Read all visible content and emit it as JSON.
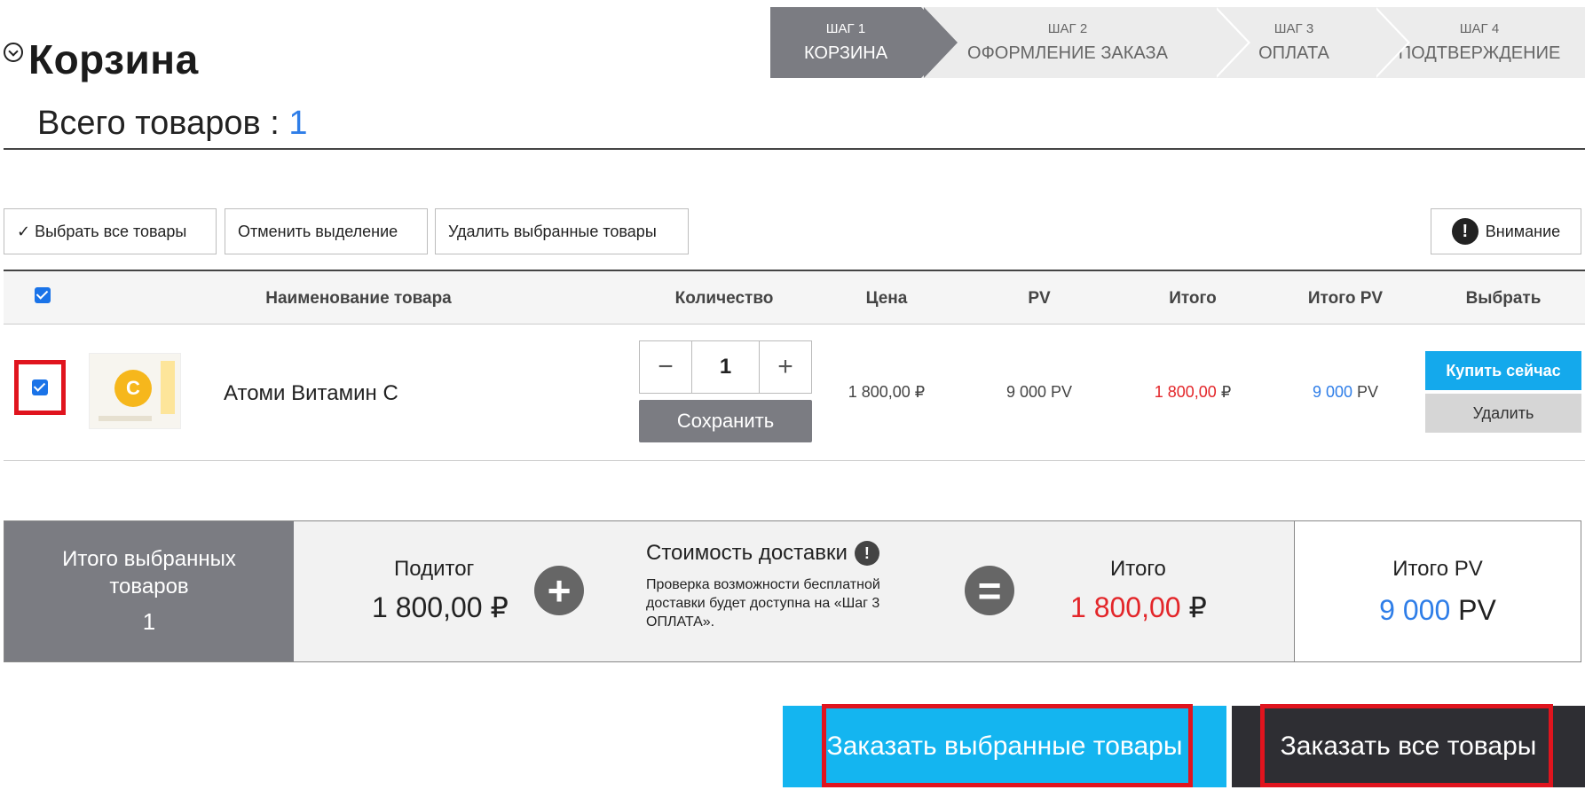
{
  "header": {
    "title": "Корзина",
    "total_label": "Всего товаров : ",
    "total_count": "1"
  },
  "steps": [
    {
      "step": "ШАГ 1",
      "label": "КОРЗИНА",
      "active": true
    },
    {
      "step": "ШАГ 2",
      "label": "ОФОРМЛЕНИЕ ЗАКАЗА",
      "active": false
    },
    {
      "step": "ШАГ 3",
      "label": "ОПЛАТА",
      "active": false
    },
    {
      "step": "ШАГ 4",
      "label": "ПОДТВЕРЖДЕНИЕ",
      "active": false
    }
  ],
  "toolbar": {
    "select_all": "✓ Выбрать все товары",
    "deselect": "Отменить выделение",
    "delete_selected": "Удалить выбранные товары",
    "attention": "Внимание",
    "attention_icon": "!"
  },
  "table": {
    "headers": {
      "name": "Наименование товара",
      "qty": "Количество",
      "price": "Цена",
      "pv": "PV",
      "total": "Итого",
      "total_pv": "Итого PV",
      "select": "Выбрать"
    },
    "rows": [
      {
        "checked": true,
        "name": "Атоми Витамин С",
        "qty": "1",
        "qty_minus": "−",
        "qty_plus": "+",
        "save": "Сохранить",
        "price": "1 800,00 ₽",
        "pv": "9 000 PV",
        "total_value": "1 800,00",
        "total_currency": " ₽",
        "total_pv_value": "9 000",
        "total_pv_unit": " PV",
        "buy_now": "Купить сейчас",
        "delete": "Удалить",
        "thumb_letter": "C"
      }
    ]
  },
  "summary": {
    "selected_label": "Итого выбранных товаров",
    "selected_count": "1",
    "subtotal_label": "Подитог",
    "subtotal_value": "1 800,00 ₽",
    "plus_sign": "+",
    "shipping_title": "Стоимость доставки",
    "shipping_note": "Проверка возможности бесплатной доставки будет доступна на «Шаг 3 ОПЛАТА».",
    "equals_sign": "=",
    "total_label": "Итого",
    "total_value": "1 800,00",
    "total_currency": " ₽",
    "total_pv_label": "Итого PV",
    "total_pv_value": "9 000",
    "total_pv_unit": " PV"
  },
  "actions": {
    "order_selected": "Заказать выбранные товары",
    "order_all": "Заказать все товары"
  },
  "colors": {
    "accent_blue": "#14a9ec",
    "highlight_red": "#e0141e",
    "price_red": "#e3262a",
    "pv_blue": "#2f7ee8",
    "dark_button": "#2e2e33",
    "step_active": "#7b7c82"
  }
}
